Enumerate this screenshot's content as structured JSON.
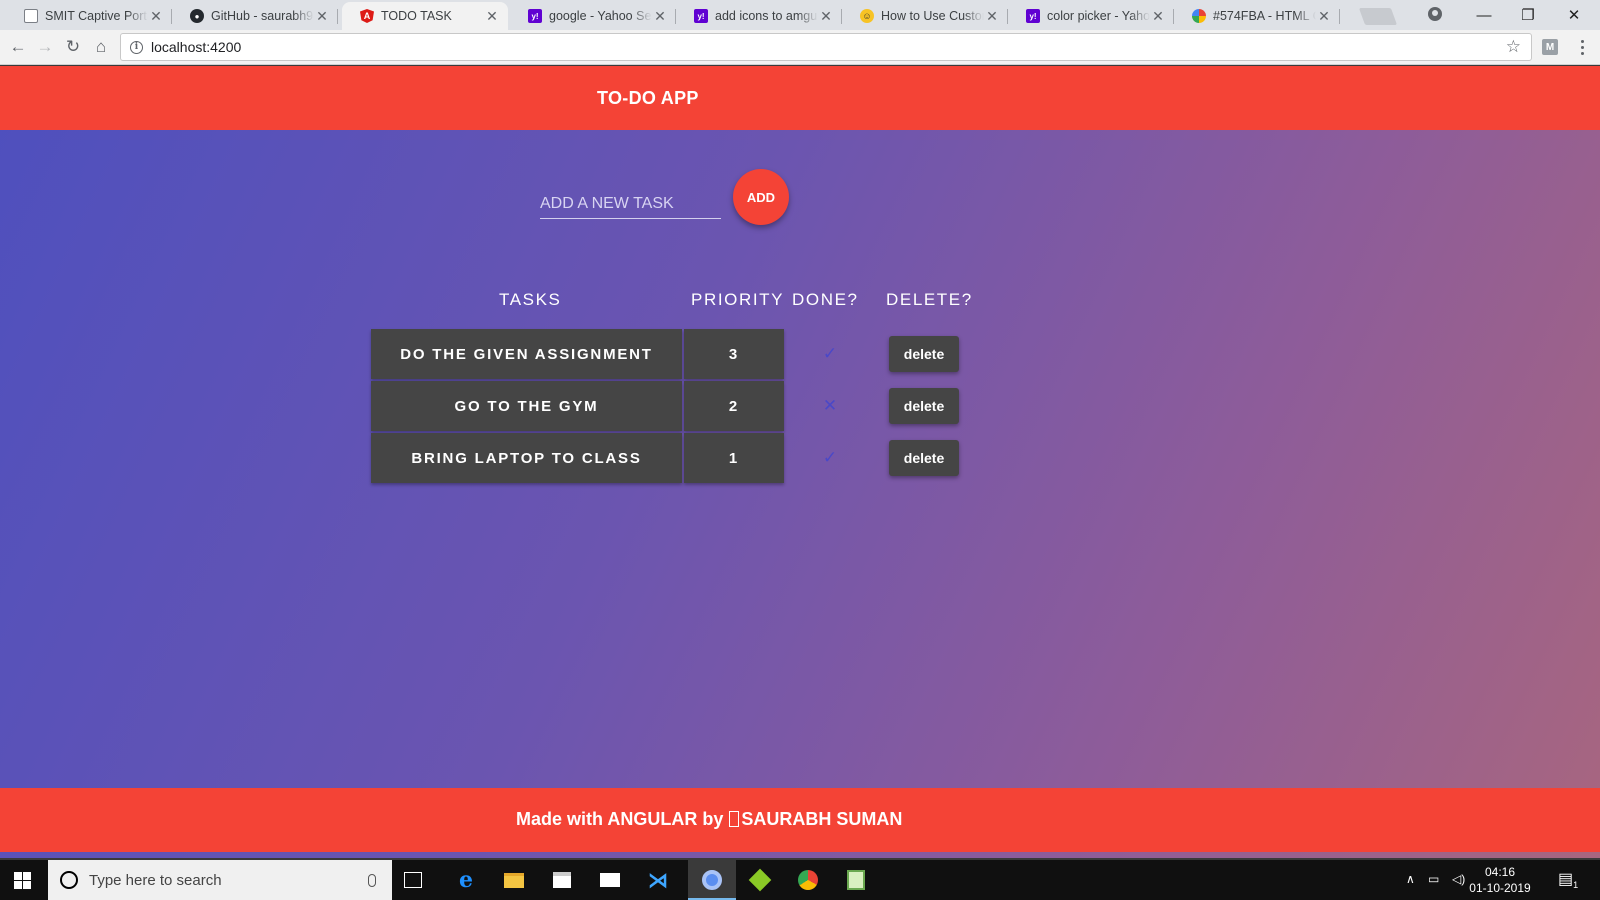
{
  "browser": {
    "tabs": [
      {
        "label": "SMIT Captive Portal",
        "icon": "document-icon",
        "active": false
      },
      {
        "label": "GitHub - saurabh98",
        "icon": "github-icon",
        "active": false
      },
      {
        "label": "TODO TASK",
        "icon": "angular-icon",
        "active": true
      },
      {
        "label": "google - Yahoo Sear",
        "icon": "yahoo-icon",
        "active": false
      },
      {
        "label": "add icons to amgula",
        "icon": "yahoo-icon",
        "active": false
      },
      {
        "label": "How to Use Custom",
        "icon": "emoji-icon",
        "active": false
      },
      {
        "label": "color picker - Yahoo",
        "icon": "yahoo-icon",
        "active": false
      },
      {
        "label": "#574FBA - HTML Co",
        "icon": "color-wheel-icon",
        "active": false
      }
    ],
    "url": "localhost:4200",
    "extension_letter": "M"
  },
  "app": {
    "title": "TO-DO APP",
    "input_placeholder": "ADD A NEW TASK",
    "add_label": "ADD",
    "columns": {
      "tasks": "TASKS",
      "priority": "PRIORITY",
      "done": "DONE?",
      "delete": "DELETE?"
    },
    "rows": [
      {
        "task": "DO THE GIVEN ASSIGNMENT",
        "priority": "3",
        "done": "✓",
        "delete_label": "delete"
      },
      {
        "task": "GO TO THE GYM",
        "priority": "2",
        "done": "✕",
        "delete_label": "delete"
      },
      {
        "task": "BRING LAPTOP TO CLASS",
        "priority": "1",
        "done": "✓",
        "delete_label": "delete"
      }
    ],
    "footer": {
      "prefix": "Made with ANGULAR by",
      "author": "SAURABH SUMAN"
    }
  },
  "taskbar": {
    "search_placeholder": "Type here to search",
    "time": "04:16",
    "date": "01-10-2019",
    "notification_count": "1"
  },
  "colors": {
    "accent_red": "#f44336",
    "card_gray": "#454545",
    "gradient_start": "#4e50be",
    "gradient_end": "#a8667f"
  }
}
